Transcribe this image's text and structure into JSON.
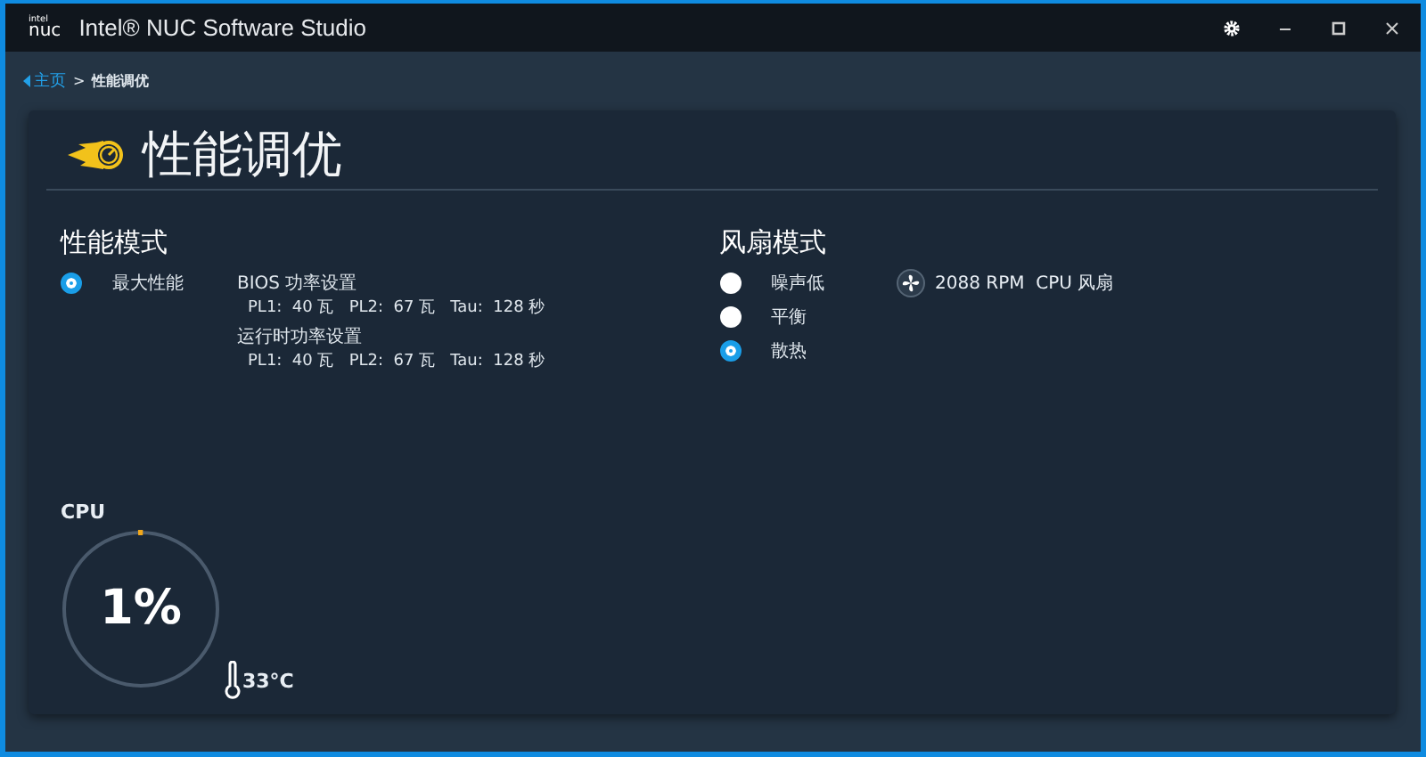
{
  "window": {
    "logo_top": "intel",
    "logo_bottom": "nuc",
    "title": "Intel® NUC Software Studio"
  },
  "breadcrumb": {
    "home": "主页",
    "separator": ">",
    "current": "性能调优"
  },
  "page_title": "性能调优",
  "performance_mode": {
    "heading": "性能模式",
    "options": [
      {
        "label": "最大性能",
        "selected": true
      }
    ],
    "settings": [
      {
        "title": "BIOS 功率设置",
        "values": "PL1:  40 瓦   PL2:  67 瓦   Tau:  128 秒"
      },
      {
        "title": "运行时功率设置",
        "values": "PL1:  40 瓦   PL2:  67 瓦   Tau:  128 秒"
      }
    ]
  },
  "fan_mode": {
    "heading": "风扇模式",
    "options": [
      {
        "label": "噪声低",
        "selected": false
      },
      {
        "label": "平衡",
        "selected": false
      },
      {
        "label": "散热",
        "selected": true
      }
    ],
    "fan_reading": "2088 RPM  CPU 风扇"
  },
  "cpu": {
    "label": "CPU",
    "reading": "1%",
    "level": 0.01,
    "temperature": "33°C"
  }
}
